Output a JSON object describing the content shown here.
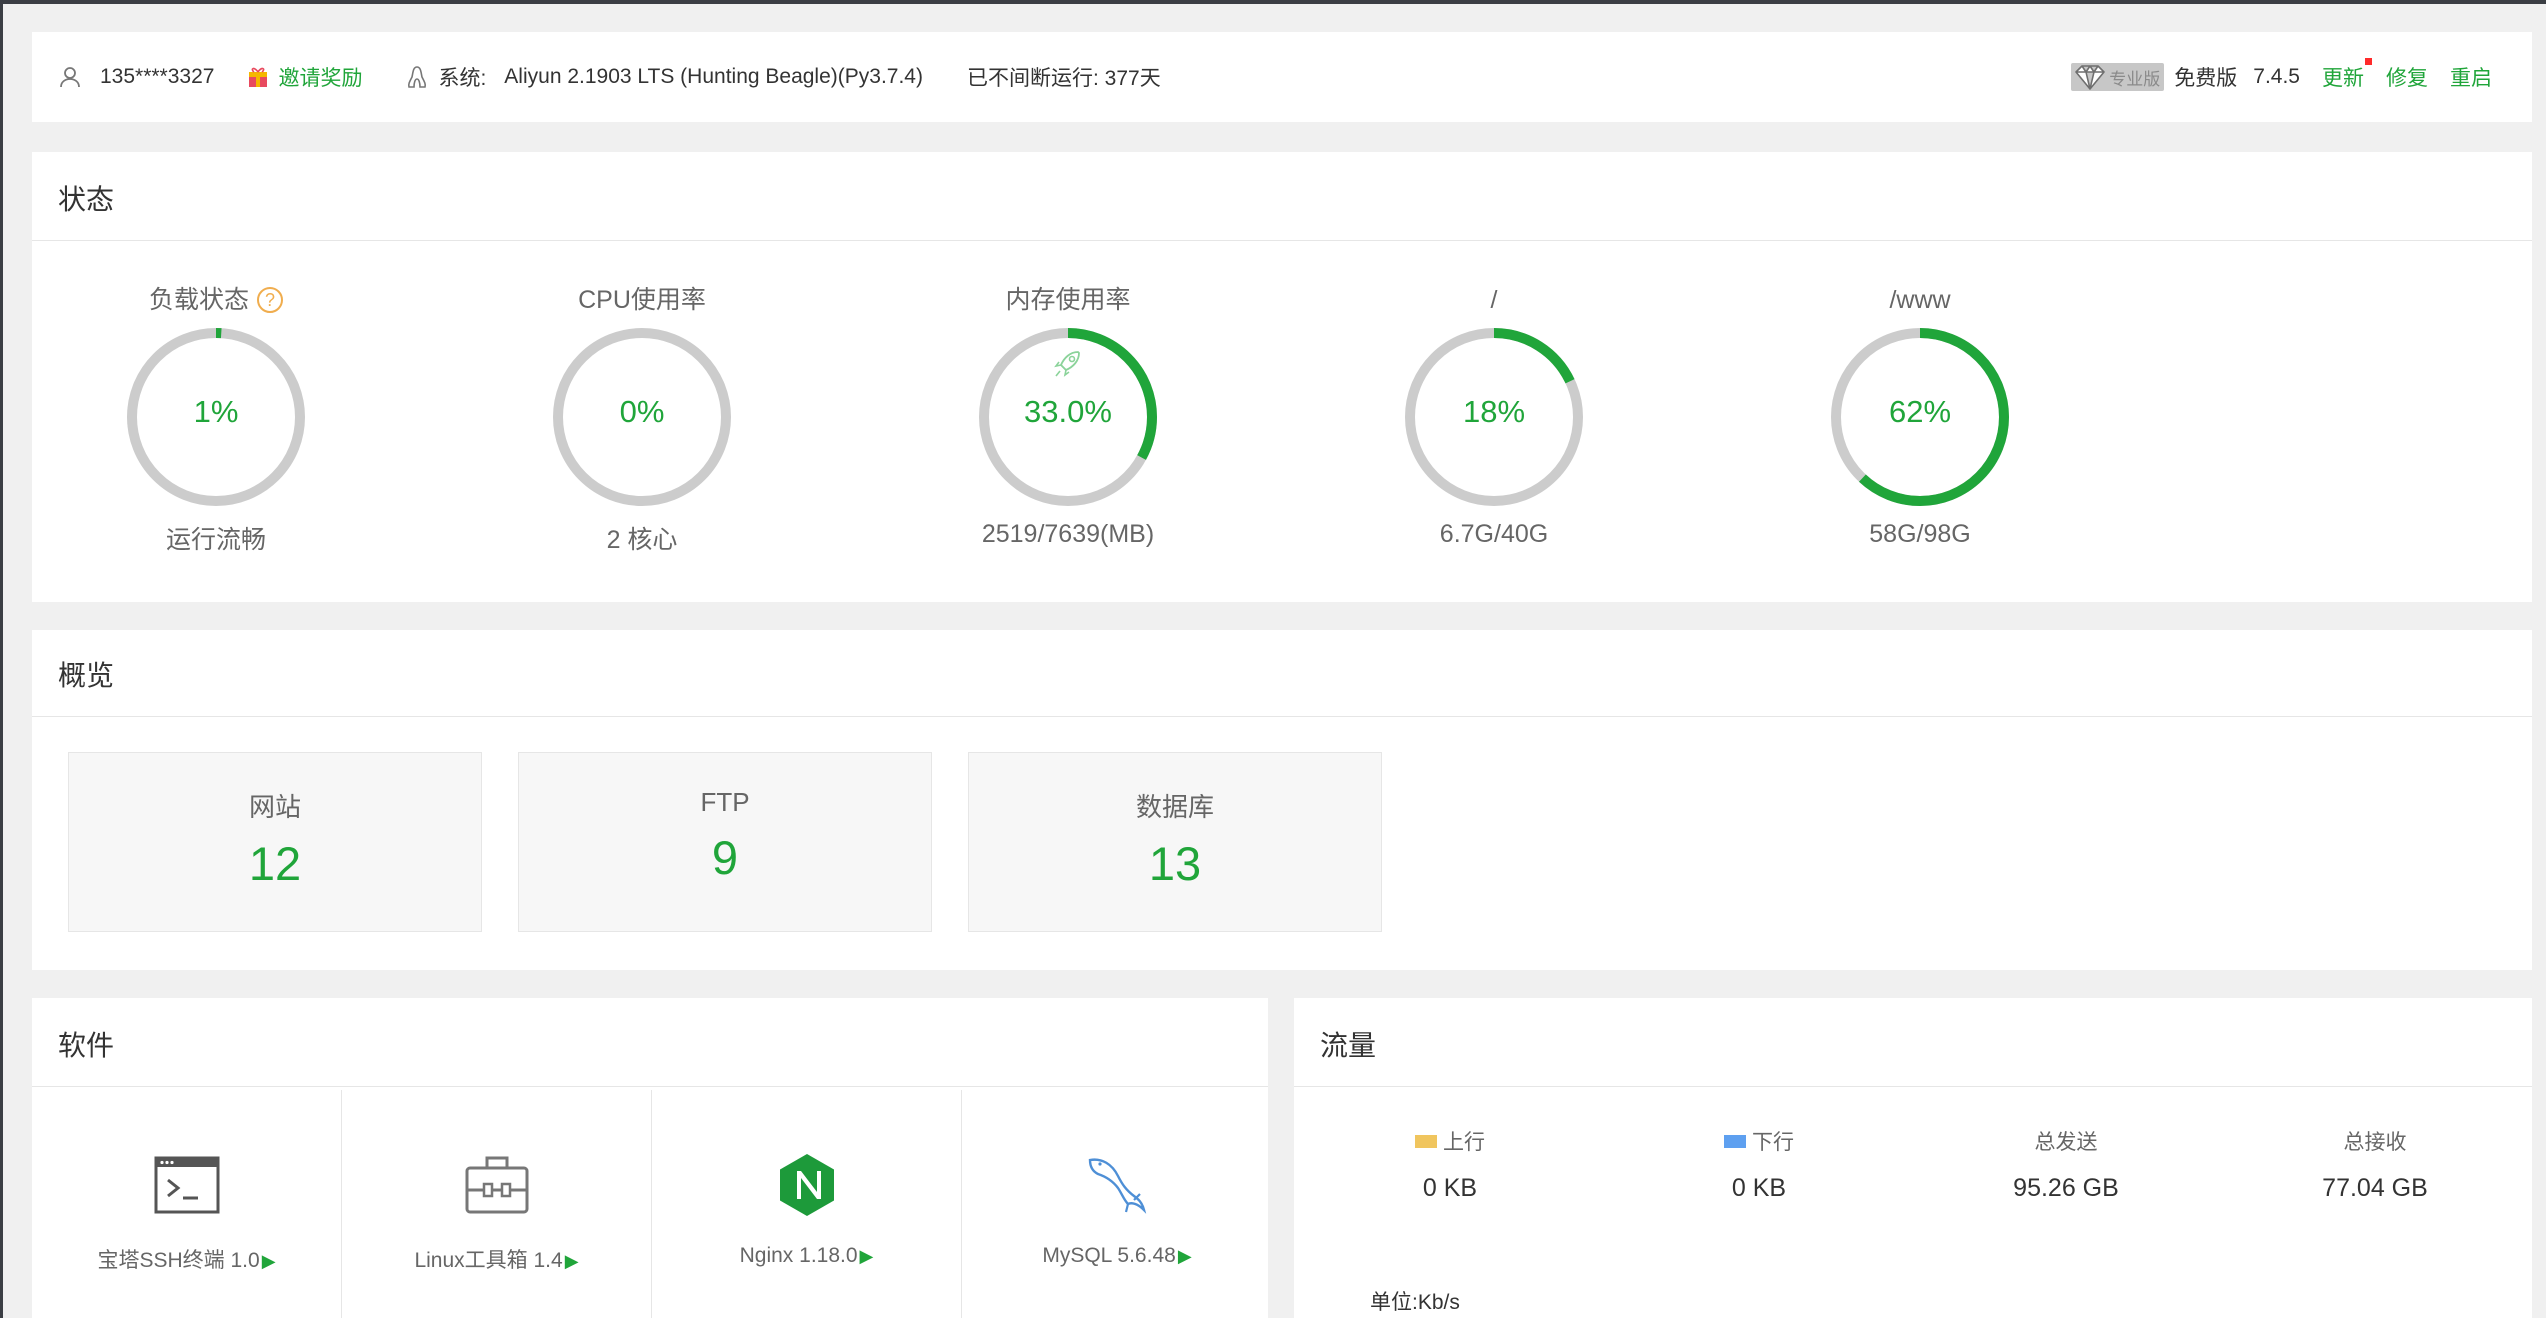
{
  "topbar": {
    "user": "135****3327",
    "invite": "邀请奖励",
    "system_label": "系统:",
    "system_value": "Aliyun 2.1903 LTS (Hunting Beagle)(Py3.7.4)",
    "uptime": "已不间断运行: 377天",
    "pro_badge": "专业版",
    "edition": "免费版",
    "version": "7.4.5",
    "update": "更新",
    "repair": "修复",
    "restart": "重启"
  },
  "status": {
    "title": "状态",
    "gauges": [
      {
        "label": "负载状态",
        "value": "1%",
        "sub": "运行流畅",
        "percent": 1
      },
      {
        "label": "CPU使用率",
        "value": "0%",
        "sub": "2 核心",
        "percent": 0
      },
      {
        "label": "内存使用率",
        "value": "33.0%",
        "sub": "2519/7639(MB)",
        "percent": 33
      },
      {
        "label": "/",
        "value": "18%",
        "sub": "6.7G/40G",
        "percent": 18
      },
      {
        "label": "/www",
        "value": "62%",
        "sub": "58G/98G",
        "percent": 62
      }
    ]
  },
  "overview": {
    "title": "概览",
    "cards": [
      {
        "name": "网站",
        "count": "12"
      },
      {
        "name": "FTP",
        "count": "9"
      },
      {
        "name": "数据库",
        "count": "13"
      }
    ]
  },
  "software": {
    "title": "软件",
    "items": [
      {
        "name": "宝塔SSH终端 1.0",
        "icon": "terminal-icon"
      },
      {
        "name": "Linux工具箱 1.4",
        "icon": "toolbox-icon"
      },
      {
        "name": "Nginx 1.18.0",
        "icon": "nginx-icon"
      },
      {
        "name": "MySQL 5.6.48",
        "icon": "mysql-dolphin-icon"
      }
    ]
  },
  "traffic": {
    "title": "流量",
    "up_label": "上行",
    "down_label": "下行",
    "sent_label": "总发送",
    "recv_label": "总接收",
    "up_value": "0 KB",
    "down_value": "0 KB",
    "sent_value": "95.26 GB",
    "recv_value": "77.04 GB",
    "unit": "单位:Kb/s",
    "up_color": "#f0c55e",
    "down_color": "#5ea0f0"
  },
  "colors": {
    "accent": "#20a53a",
    "ring_track": "#cccccc",
    "help": "#f0ad4e"
  }
}
